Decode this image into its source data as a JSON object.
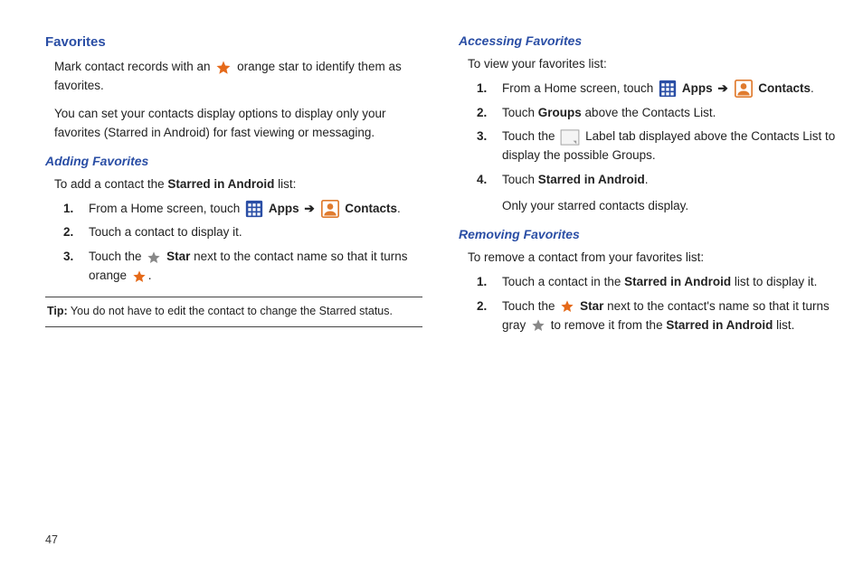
{
  "page_number": "47",
  "left": {
    "favorites_heading": "Favorites",
    "intro1a": "Mark contact records with an",
    "intro1b": "orange star to identify them as favorites.",
    "intro2": "You can set your contacts display options to display only your favorites (Starred in Android) for fast viewing or messaging.",
    "adding_heading": "Adding Favorites",
    "adding_intro_a": "To add a contact the ",
    "adding_intro_b": "Starred in Android",
    "adding_intro_c": " list:",
    "step1a": "From a Home screen, touch ",
    "apps": "Apps",
    "contacts": "Contacts",
    "step2": "Touch a contact to display it.",
    "step3a": "Touch the ",
    "star_label": "Star",
    "step3b": " next to the contact name so that it turns orange ",
    "tip_label": "Tip:",
    "tip_text": " You do not have to edit the contact to change the Starred status."
  },
  "right": {
    "accessing_heading": "Accessing Favorites",
    "accessing_intro": "To view your favorites list:",
    "a_step1a": "From a Home screen, touch ",
    "apps": "Apps",
    "contacts": "Contacts",
    "a_step2a": "Touch ",
    "groups": "Groups",
    "a_step2b": " above the Contacts List.",
    "a_step3a": "Touch the ",
    "a_step3b": " Label tab displayed above the Contacts List to display the possible Groups.",
    "a_step4a": "Touch ",
    "starred": "Starred in Android",
    "a_step5": "Only your starred contacts display.",
    "removing_heading": "Removing Favorites",
    "removing_intro": "To remove a contact from your favorites list:",
    "r_step1a": "Touch a contact in the ",
    "r_step1b": " list to display it.",
    "r_step2a": "Touch the ",
    "star_label": "Star",
    "r_step2b": " next to the contact's name so that it turns gray ",
    "r_step2c": " to remove it from the ",
    "r_step2d": " list."
  }
}
